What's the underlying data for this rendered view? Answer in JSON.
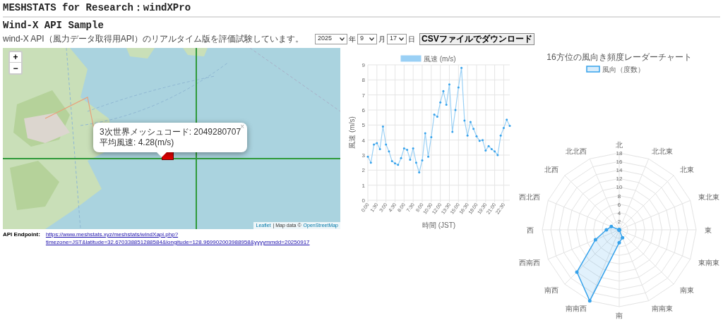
{
  "page_title": "MESHSTATS for Research：windXPro",
  "section_title": "Wind-X API Sample",
  "description": "wind-X API（風力データ取得用API）のリアルタイム版を評価試験しています。",
  "date_selects": [
    {
      "value": "2025",
      "unit": "年"
    },
    {
      "value": "9",
      "unit": "月"
    },
    {
      "value": "17",
      "unit": "日"
    }
  ],
  "download_button": "CSVファイルでダウンロード",
  "map": {
    "zoom_in": "+",
    "zoom_out": "−",
    "popup": {
      "lines": [
        "3次世界メッシュコード: 2049280707",
        "平均風速: 4.28(m/s)"
      ],
      "close": "×"
    },
    "attribution": {
      "link_1": "Leaflet",
      "text": "| Map data ©",
      "link_2": "OpenStreetMap"
    }
  },
  "api_endpoint": {
    "label": "API Endpoint:",
    "url": "https://www.meshstats.xyz/meshstats/windXapi.php?timezone=JST&latitude=32.670338851288584&longitude=128.969902003988958&yyyymmdd=20250917"
  },
  "line_chart": {
    "chart_data": {
      "type": "line",
      "grid": true,
      "xlabel": "時間 (JST)",
      "ylabel": "風速 (m/s)",
      "ylim": [
        0,
        9
      ],
      "yticks": [
        0,
        1,
        2,
        3,
        4,
        5,
        6,
        7,
        8,
        9
      ],
      "xlim": [
        0,
        23.5
      ],
      "x": [
        0,
        0.5,
        1,
        1.5,
        2,
        2.5,
        3,
        3.5,
        4,
        4.5,
        5,
        5.5,
        6,
        6.5,
        7,
        7.5,
        8,
        8.5,
        9,
        9.5,
        10,
        10.5,
        11,
        11.5,
        12,
        12.5,
        13,
        13.5,
        14,
        14.5,
        15,
        15.5,
        16,
        16.5,
        17,
        17.5,
        18,
        18.5,
        19,
        19.5,
        20,
        20.5,
        21,
        21.5,
        22,
        22.5,
        23,
        23.5
      ],
      "xticks": [
        {
          "value": 0,
          "label": "0:00"
        },
        {
          "value": 1.5,
          "label": "1:30"
        },
        {
          "value": 3,
          "label": "3:00"
        },
        {
          "value": 4.5,
          "label": "4:30"
        },
        {
          "value": 6,
          "label": "6:00"
        },
        {
          "value": 7.5,
          "label": "7:30"
        },
        {
          "value": 9,
          "label": "9:00"
        },
        {
          "value": 10.5,
          "label": "10:30"
        },
        {
          "value": 12,
          "label": "12:00"
        },
        {
          "value": 13.5,
          "label": "13:30"
        },
        {
          "value": 15,
          "label": "15:00"
        },
        {
          "value": 16.5,
          "label": "16:30"
        },
        {
          "value": 18,
          "label": "18:00"
        },
        {
          "value": 19.5,
          "label": "19:30"
        },
        {
          "value": 21,
          "label": "21:00"
        },
        {
          "value": 22.5,
          "label": "22:30"
        }
      ],
      "series": [
        {
          "name": "風速 (m/s)",
          "color": "#9ad0f5",
          "values": [
            2.9,
            2.5,
            3.7,
            3.8,
            3.4,
            4.9,
            3.7,
            3.25,
            2.6,
            2.45,
            2.35,
            2.8,
            3.45,
            3.35,
            2.7,
            3.45,
            2.5,
            1.85,
            2.65,
            4.45,
            2.9,
            4.2,
            5.7,
            5.55,
            6.5,
            7.25,
            6.35,
            7.7,
            4.55,
            6.0,
            7.5,
            8.8,
            5.3,
            4.3,
            5.2,
            4.75,
            4.25,
            3.95,
            4.0,
            3.3,
            3.6,
            3.4,
            3.25,
            3.0,
            4.3,
            4.8,
            5.35,
            4.95
          ]
        }
      ]
    }
  },
  "radar_chart": {
    "chart_data": {
      "type": "radar",
      "grid": true,
      "title": "16方位の風向き頻度レーダーチャート",
      "ylim": [
        0,
        18
      ],
      "yticks": [
        2,
        4,
        6,
        8,
        10,
        12,
        14,
        16,
        18
      ],
      "categories": [
        "北",
        "北北東",
        "北東",
        "東北東",
        "東",
        "東南東",
        "南東",
        "南南東",
        "南",
        "南南西",
        "南西",
        "西南西",
        "西",
        "西北西",
        "北西",
        "北北西"
      ],
      "series": [
        {
          "name": "風向（度数）",
          "color": "#36a2eb",
          "values": [
            0,
            0,
            0,
            0,
            0,
            0,
            0,
            2,
            3,
            18,
            14,
            6,
            3,
            2,
            0,
            0
          ]
        }
      ]
    }
  }
}
